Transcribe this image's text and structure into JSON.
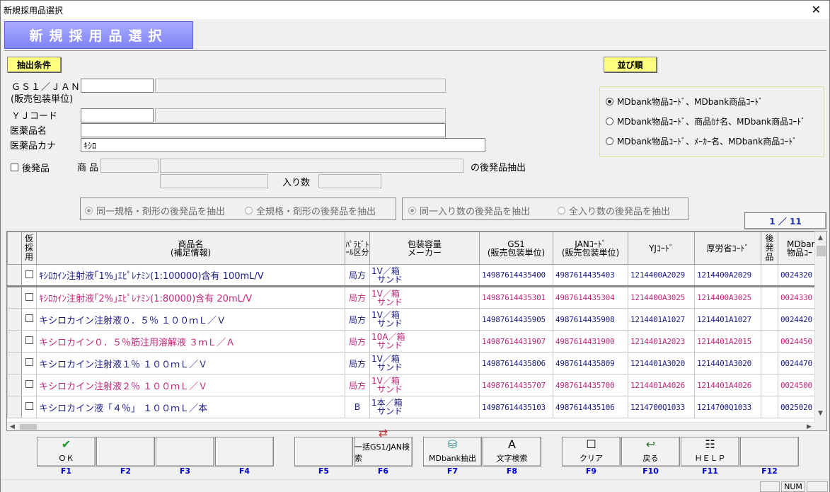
{
  "window": {
    "title": "新規採用品選択",
    "close_glyph": "✕"
  },
  "banner": "新規採用品選択",
  "conditions": {
    "header": "抽出条件",
    "gs1_label": "ＧＳ１／ＪＡＮ",
    "gs1_sublabel": "(販売包装単位)",
    "yj_label": "ＹＪコード",
    "name_label": "医薬品名",
    "kana_label": "医薬品カナ",
    "kana_value": "ｷｼﾛ",
    "generic_label": "後発品",
    "product_label": "商 品",
    "generic_suffix": "の後発品抽出",
    "quantity_label": "入り数",
    "group1": [
      {
        "label": "同一規格・剤形の後発品を抽出",
        "checked": true
      },
      {
        "label": "全規格・剤形の後発品を抽出",
        "checked": false
      }
    ],
    "group2": [
      {
        "label": "同一入り数の後発品を抽出",
        "checked": true
      },
      {
        "label": "全入り数の後発品を抽出",
        "checked": false
      }
    ]
  },
  "sort": {
    "header": "並び順",
    "options": [
      {
        "label": "MDbank物品ｺｰﾄﾞ、MDbank商品ｺｰﾄﾞ",
        "checked": true
      },
      {
        "label": "MDbank物品ｺｰﾄﾞ、商品ｶﾅ名、MDbank商品ｺｰﾄﾞ",
        "checked": false
      },
      {
        "label": "MDbank物品ｺｰﾄﾞ、ﾒｰｶｰ名、MDbank商品ｺｰﾄﾞ",
        "checked": false
      }
    ]
  },
  "pager": "1 ／ 11",
  "table": {
    "headers": {
      "adopt": "仮採用",
      "name1": "商品名",
      "name2": "(補足情報)",
      "para": "ﾊﾟﾗﾋﾞﾄｰﾙ区分",
      "pack1": "包装容量",
      "pack2": "メーカー",
      "gs1a": "GS1",
      "gs1b": "(販売包装単位)",
      "jana": "JANｺｰﾄﾞ",
      "janb": "(販売包装単位)",
      "yj": "YJｺｰﾄﾞ",
      "mhlw": "厚労省ｺｰﾄﾞ",
      "generic": "後発品",
      "mdb1": "MDbar",
      "mdb2": "物品ｺｰ"
    },
    "rows": [
      {
        "name": "ｷｼﾛｶｲﾝ注射液｢1%｣ｴﾋﾟﾚﾅﾐﾝ(1:100000)含有 100mL/V",
        "para": "局方",
        "pack1": "1V／箱",
        "pack2": "サンド",
        "gs1": "14987614435400",
        "jan": "4987614435403",
        "yj": "1214400A2029",
        "mhlw": "1214400A2029",
        "mdb": "0024320",
        "color": "blue"
      },
      {
        "name": "ｷｼﾛｶｲﾝ注射液｢2%｣ｴﾋﾟﾚﾅﾐﾝ(1:80000)含有 20mL/V",
        "para": "局方",
        "pack1": "1V／箱",
        "pack2": "サンド",
        "gs1": "14987614435301",
        "jan": "4987614435304",
        "yj": "1214400A3025",
        "mhlw": "1214400A3025",
        "mdb": "0024330",
        "color": "pink"
      },
      {
        "name": "キシロカイン注射液０．５％ １００ｍＬ／Ｖ",
        "para": "局方",
        "pack1": "1V／箱",
        "pack2": "サンド",
        "gs1": "14987614435905",
        "jan": "4987614435908",
        "yj": "1214401A1027",
        "mhlw": "1214401A1027",
        "mdb": "0024420",
        "color": "blue"
      },
      {
        "name": "キシロカイン０．５％筋注用溶解液 ３ｍＬ／Ａ",
        "para": "局方",
        "pack1": "10A／箱",
        "pack2": "サンド",
        "gs1": "14987614431907",
        "jan": "4987614431900",
        "yj": "1214401A2023",
        "mhlw": "1214401A2015",
        "mdb": "0024450",
        "color": "pink"
      },
      {
        "name": "キシロカイン注射液１％ １００ｍＬ／Ｖ",
        "para": "局方",
        "pack1": "1V／箱",
        "pack2": "サンド",
        "gs1": "14987614435806",
        "jan": "4987614435809",
        "yj": "1214401A3020",
        "mhlw": "1214401A3020",
        "mdb": "0024470",
        "color": "blue"
      },
      {
        "name": "キシロカイン注射液２％ １００ｍＬ／Ｖ",
        "para": "局方",
        "pack1": "1V／箱",
        "pack2": "サンド",
        "gs1": "14987614435707",
        "jan": "4987614435700",
        "yj": "1214401A4026",
        "mhlw": "1214401A4026",
        "mdb": "0024500",
        "color": "pink"
      },
      {
        "name": "キシロカイン液「４％」 １００ｍＬ／本",
        "para": "B",
        "pack1": "1本／箱",
        "pack2": "サンド",
        "gs1": "14987614435103",
        "jan": "4987614435106",
        "yj": "1214700Q1033",
        "mhlw": "1214700Q1033",
        "mdb": "0025020",
        "color": "blue"
      }
    ]
  },
  "fkeys": [
    {
      "icon": "✔",
      "label": "ＯＫ",
      "key": "F1"
    },
    {
      "icon": "",
      "label": "",
      "key": "F2"
    },
    {
      "icon": "",
      "label": "",
      "key": "F3"
    },
    {
      "icon": "",
      "label": "",
      "key": "F4"
    },
    {
      "icon": "",
      "label": "",
      "key": "F5"
    },
    {
      "icon": "⇄",
      "label": "一括GS1/JAN検索",
      "key": "F6"
    },
    {
      "icon": "⛁",
      "label": "MDbank抽出",
      "key": "F7"
    },
    {
      "icon": "A",
      "label": "文字検索",
      "key": "F8"
    },
    {
      "icon": "☐",
      "label": "クリア",
      "key": "F9"
    },
    {
      "icon": "↩",
      "label": "戻る",
      "key": "F10"
    },
    {
      "icon": "☷",
      "label": "ＨＥＬＰ",
      "key": "F11"
    },
    {
      "icon": "",
      "label": "",
      "key": "F12"
    }
  ],
  "status": {
    "num": "NUM"
  },
  "colors": {
    "blue_row": "#1a1a8a",
    "pink_row": "#c0267a",
    "fkey": "#0000cc",
    "section_label_bg": "#ffff80"
  }
}
